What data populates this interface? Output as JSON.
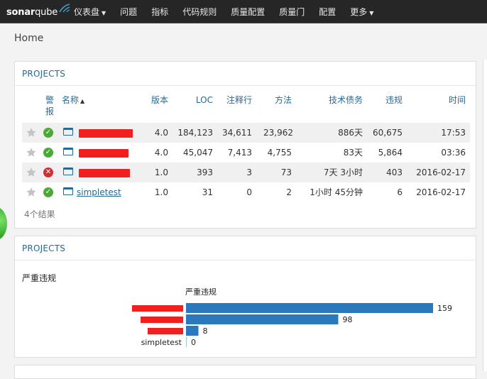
{
  "nav": {
    "logo": {
      "part1": "sonar",
      "part2": "qube"
    },
    "items": [
      {
        "label": "仪表盘",
        "dropdown": true
      },
      {
        "label": "问题",
        "dropdown": false
      },
      {
        "label": "指标",
        "dropdown": false
      },
      {
        "label": "代码规则",
        "dropdown": false
      },
      {
        "label": "质量配置",
        "dropdown": false
      },
      {
        "label": "质量门",
        "dropdown": false
      },
      {
        "label": "配置",
        "dropdown": false
      },
      {
        "label": "更多",
        "dropdown": true
      }
    ]
  },
  "breadcrumb": "Home",
  "projects_widget": {
    "title": "PROJECTS",
    "columns": {
      "alert": "警报",
      "name": "名称",
      "name_sort": "▲",
      "version": "版本",
      "loc": "LOC",
      "comment_lines": "注释行",
      "methods": "方法",
      "tech_debt": "技术债务",
      "violations": "违规",
      "time": "时间"
    },
    "rows": [
      {
        "name": "",
        "redacted": true,
        "status": "ok",
        "version": "4.0",
        "loc": "184,123",
        "comment_lines": "34,611",
        "methods": "23,962",
        "tech_debt": "886天",
        "violations": "60,675",
        "time": "17:53"
      },
      {
        "name": "",
        "redacted": true,
        "status": "ok",
        "version": "4.0",
        "loc": "45,047",
        "comment_lines": "7,413",
        "methods": "4,755",
        "tech_debt": "83天",
        "violations": "5,864",
        "time": "03:36"
      },
      {
        "name": "",
        "redacted": true,
        "status": "error",
        "version": "1.0",
        "loc": "393",
        "comment_lines": "3",
        "methods": "73",
        "tech_debt": "7天 3小时",
        "violations": "403",
        "time": "2016-02-17"
      },
      {
        "name": "simpletest",
        "redacted": false,
        "status": "ok",
        "version": "1.0",
        "loc": "31",
        "comment_lines": "0",
        "methods": "2",
        "tech_debt": "1小时 45分钟",
        "violations": "6",
        "time": "2016-02-17"
      }
    ],
    "footer": "4个结果"
  },
  "chart_widget": {
    "title": "PROJECTS",
    "heading": "严重违规"
  },
  "chart_data": {
    "type": "bar",
    "orientation": "horizontal",
    "title": "严重违规",
    "categories": [
      "",
      "",
      "",
      "simpletest"
    ],
    "values": [
      159,
      98,
      8,
      0
    ],
    "xlim": [
      0,
      159
    ],
    "grid": false,
    "legend": "none",
    "bar_color": "#2a79bd"
  },
  "colors": {
    "accent": "#236a97",
    "nav_bg": "#262626",
    "ok": "#4aaa36",
    "error": "#d02f3a",
    "redaction": "#f02020"
  }
}
